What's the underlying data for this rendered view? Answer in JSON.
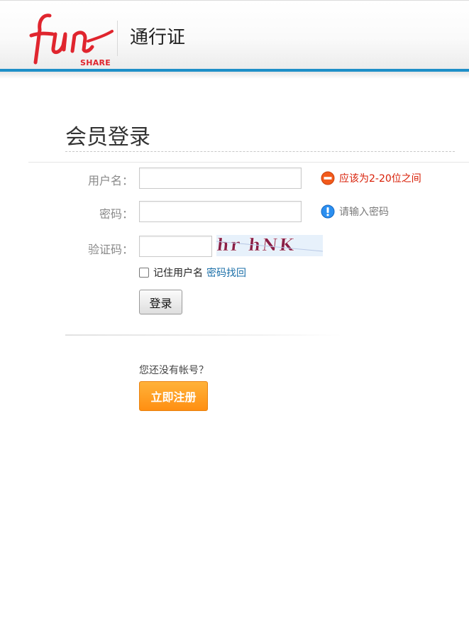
{
  "header": {
    "logo_text": "fun",
    "logo_subtext": "SHARE",
    "title": "通行证"
  },
  "page": {
    "title": "会员登录"
  },
  "form": {
    "username": {
      "label": "用户名：",
      "value": "",
      "error": "应该为2-20位之间"
    },
    "password": {
      "label": "密码：",
      "value": "",
      "hint": "请输入密码"
    },
    "captcha": {
      "label": "验证码：",
      "value": "",
      "image_text": "hr hNK"
    },
    "remember_label": "记住用户名",
    "forgot_link": "密码找回",
    "login_button": "登录"
  },
  "register": {
    "prompt": "您还没有帐号？",
    "button": "立即注册"
  },
  "colors": {
    "brand_red": "#e0252e",
    "header_accent": "#1e8fc8",
    "error_red": "#d81e06",
    "info_blue": "#1e88e5",
    "register_orange": "#ff9a1f",
    "link_blue": "#1b6fa8"
  },
  "icons": {
    "error": "minus-circle-icon",
    "info": "exclamation-circle-icon"
  }
}
